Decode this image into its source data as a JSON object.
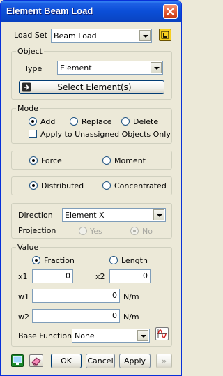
{
  "window": {
    "title": "Element Beam Load"
  },
  "load_set": {
    "label": "Load Set",
    "value": "Beam Load"
  },
  "object": {
    "group_label": "Object",
    "type_label": "Type",
    "type_value": "Element",
    "select_button": "Select Element(s)"
  },
  "mode": {
    "group_label": "Mode",
    "options": [
      "Add",
      "Replace",
      "Delete"
    ],
    "selected": "Add",
    "unassigned_only": "Apply to Unassigned Objects Only"
  },
  "load_kind": {
    "options": [
      "Force",
      "Moment"
    ],
    "selected": "Force"
  },
  "distribution": {
    "options": [
      "Distributed",
      "Concentrated"
    ],
    "selected": "Distributed"
  },
  "direction": {
    "label": "Direction",
    "value": "Element X",
    "projection_label": "Projection",
    "yes": "Yes",
    "no": "No"
  },
  "value": {
    "group_label": "Value",
    "options": [
      "Fraction",
      "Length"
    ],
    "selected": "Fraction",
    "x1_label": "x1",
    "x1": "0",
    "x2_label": "x2",
    "x2": "0",
    "w1_label": "w1",
    "w1": "0",
    "w1_unit": "N/m",
    "w2_label": "w2",
    "w2": "0",
    "w2_unit": "N/m",
    "base_function_label": "Base Function",
    "base_function_value": "None"
  },
  "footer": {
    "ok": "OK",
    "cancel": "Cancel",
    "apply": "Apply",
    "more": "»"
  },
  "colors": {
    "title_blue": "#0b4ed7",
    "close_red": "#e0542b",
    "face": "#ece9d8"
  }
}
